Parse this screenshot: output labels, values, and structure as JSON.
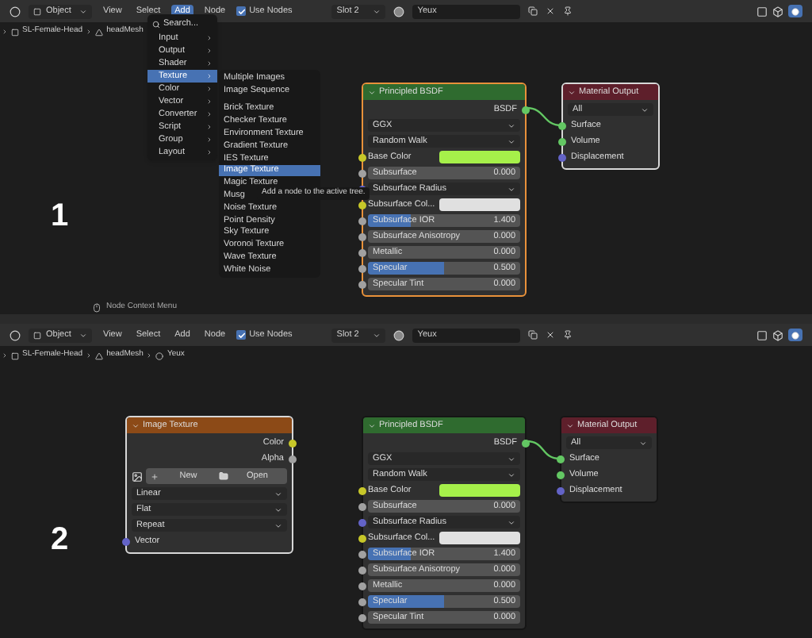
{
  "panels": [
    {
      "number": "1",
      "header": {
        "mode": "Object",
        "menus": [
          {
            "label": "View",
            "selected": false
          },
          {
            "label": "Select",
            "selected": false
          },
          {
            "label": "Add",
            "selected": true
          },
          {
            "label": "Node",
            "selected": false
          }
        ],
        "use_nodes": {
          "label": "Use Nodes",
          "checked": true
        },
        "slot": "Slot 2",
        "material": "Yeux"
      },
      "breadcrumb": [
        {
          "kind": "object",
          "label": "SL-Female-Head"
        },
        {
          "kind": "mesh",
          "label": "headMesh"
        }
      ],
      "nodes": [
        {
          "kind": "shader",
          "title": "Principled BSDF",
          "active": true,
          "selected": true,
          "rows": [
            {
              "kind": "output",
              "label": "BSDF",
              "socket": {
                "color": "#63c763"
              }
            },
            {
              "kind": "dropdown",
              "label": "GGX"
            },
            {
              "kind": "dropdown",
              "label": "Random Walk"
            },
            {
              "kind": "color",
              "label": "Base Color",
              "socket": {
                "color": "#c7c729"
              },
              "color": "#a6f04a"
            },
            {
              "kind": "slider",
              "label": "Subsurface",
              "value": "0.000",
              "socket": {
                "color": "#a1a1a1"
              },
              "level": 0
            },
            {
              "kind": "dropdown",
              "label": "Subsurface Radius",
              "socket": {
                "color": "#6363c7"
              }
            },
            {
              "kind": "color",
              "label": "Subsurface Col...",
              "socket": {
                "color": "#c7c729"
              },
              "color": "#e0e0e0"
            },
            {
              "kind": "slider",
              "label": "Subsurface IOR",
              "value": "1.400",
              "socket": {
                "color": "#a1a1a1"
              },
              "level": 0.28
            },
            {
              "kind": "slider",
              "label": "Subsurface Anisotropy",
              "value": "0.000",
              "socket": {
                "color": "#a1a1a1"
              },
              "level": 0
            },
            {
              "kind": "slider",
              "label": "Metallic",
              "value": "0.000",
              "socket": {
                "color": "#a1a1a1"
              },
              "level": 0
            },
            {
              "kind": "slider",
              "label": "Specular",
              "value": "0.500",
              "socket": {
                "color": "#a1a1a1"
              },
              "level": 0.5
            },
            {
              "kind": "slider",
              "label": "Specular Tint",
              "value": "0.000",
              "socket": {
                "color": "#a1a1a1"
              },
              "level": 0
            }
          ]
        },
        {
          "kind": "output",
          "title": "Material Output",
          "active": false,
          "selected": true,
          "rows": [
            {
              "kind": "dropdown",
              "label": "All"
            },
            {
              "kind": "input",
              "label": "Surface",
              "socket": {
                "color": "#63c763"
              }
            },
            {
              "kind": "input",
              "label": "Volume",
              "socket": {
                "color": "#63c763"
              }
            },
            {
              "kind": "input",
              "label": "Displacement",
              "socket": {
                "color": "#6363c7"
              }
            }
          ]
        }
      ],
      "menu": {
        "items": [
          {
            "label": "Search...",
            "kind": "search",
            "selected": false
          },
          {
            "label": "Input",
            "kind": "submenu",
            "selected": false
          },
          {
            "label": "Output",
            "kind": "submenu",
            "selected": false
          },
          {
            "label": "Shader",
            "kind": "submenu",
            "selected": false
          },
          {
            "label": "Texture",
            "kind": "submenu",
            "selected": true
          },
          {
            "label": "Color",
            "kind": "submenu",
            "selected": false
          },
          {
            "label": "Vector",
            "kind": "submenu",
            "selected": false
          },
          {
            "label": "Converter",
            "kind": "submenu",
            "selected": false
          },
          {
            "label": "Script",
            "kind": "submenu",
            "selected": false
          },
          {
            "label": "Group",
            "kind": "submenu",
            "selected": false
          },
          {
            "label": "Layout",
            "kind": "submenu",
            "selected": false
          }
        ],
        "submenu": [
          {
            "label": "Multiple Images",
            "selected": false
          },
          {
            "label": "Image Sequence",
            "selected": false
          },
          {
            "kind": "separator"
          },
          {
            "label": "Brick Texture",
            "selected": false
          },
          {
            "label": "Checker Texture",
            "selected": false
          },
          {
            "label": "Environment Texture",
            "selected": false
          },
          {
            "label": "Gradient Texture",
            "selected": false
          },
          {
            "label": "IES Texture",
            "selected": false
          },
          {
            "label": "Image Texture",
            "selected": true
          },
          {
            "label": "Magic Texture",
            "selected": false
          },
          {
            "label": "Musg",
            "selected": false
          },
          {
            "label": "Noise Texture",
            "selected": false
          },
          {
            "label": "Point Density",
            "selected": false
          },
          {
            "label": "Sky Texture",
            "selected": false
          },
          {
            "label": "Voronoi Texture",
            "selected": false
          },
          {
            "label": "Wave Texture",
            "selected": false
          },
          {
            "label": "White Noise",
            "selected": false
          }
        ],
        "tooltip": "Add a node to the active tree."
      },
      "status": "Node Context Menu"
    },
    {
      "number": "2",
      "header": {
        "mode": "Object",
        "menus": [
          {
            "label": "View",
            "selected": false
          },
          {
            "label": "Select",
            "selected": false
          },
          {
            "label": "Add",
            "selected": false
          },
          {
            "label": "Node",
            "selected": false
          }
        ],
        "use_nodes": {
          "label": "Use Nodes",
          "checked": true
        },
        "slot": "Slot 2",
        "material": "Yeux"
      },
      "breadcrumb": [
        {
          "kind": "object",
          "label": "SL-Female-Head"
        },
        {
          "kind": "mesh",
          "label": "headMesh"
        },
        {
          "kind": "material",
          "label": "Yeux"
        }
      ],
      "nodes": [
        {
          "kind": "texture",
          "title": "Image Texture",
          "active": false,
          "selected": true,
          "rows": [
            {
              "kind": "output",
              "label": "Color",
              "socket": {
                "color": "#c7c729"
              }
            },
            {
              "kind": "output",
              "label": "Alpha",
              "socket": {
                "color": "#a1a1a1"
              }
            },
            {
              "kind": "image",
              "new": "New",
              "open": "Open"
            },
            {
              "kind": "dropdown",
              "label": "Linear"
            },
            {
              "kind": "dropdown",
              "label": "Flat"
            },
            {
              "kind": "dropdown",
              "label": "Repeat"
            },
            {
              "kind": "input",
              "label": "Vector",
              "socket": {
                "color": "#6363c7"
              }
            }
          ]
        },
        {
          "kind": "shader",
          "title": "Principled BSDF",
          "active": false,
          "selected": false,
          "rows": [
            {
              "kind": "output",
              "label": "BSDF",
              "socket": {
                "color": "#63c763"
              }
            },
            {
              "kind": "dropdown",
              "label": "GGX"
            },
            {
              "kind": "dropdown",
              "label": "Random Walk"
            },
            {
              "kind": "color",
              "label": "Base Color",
              "socket": {
                "color": "#c7c729"
              },
              "color": "#a6f04a"
            },
            {
              "kind": "slider",
              "label": "Subsurface",
              "value": "0.000",
              "socket": {
                "color": "#a1a1a1"
              },
              "level": 0
            },
            {
              "kind": "dropdown",
              "label": "Subsurface Radius",
              "socket": {
                "color": "#6363c7"
              }
            },
            {
              "kind": "color",
              "label": "Subsurface Col...",
              "socket": {
                "color": "#c7c729"
              },
              "color": "#e0e0e0"
            },
            {
              "kind": "slider",
              "label": "Subsurface IOR",
              "value": "1.400",
              "socket": {
                "color": "#a1a1a1"
              },
              "level": 0.28
            },
            {
              "kind": "slider",
              "label": "Subsurface Anisotropy",
              "value": "0.000",
              "socket": {
                "color": "#a1a1a1"
              },
              "level": 0
            },
            {
              "kind": "slider",
              "label": "Metallic",
              "value": "0.000",
              "socket": {
                "color": "#a1a1a1"
              },
              "level": 0
            },
            {
              "kind": "slider",
              "label": "Specular",
              "value": "0.500",
              "socket": {
                "color": "#a1a1a1"
              },
              "level": 0.5
            },
            {
              "kind": "slider",
              "label": "Specular Tint",
              "value": "0.000",
              "socket": {
                "color": "#a1a1a1"
              },
              "level": 0
            }
          ]
        },
        {
          "kind": "output",
          "title": "Material Output",
          "active": false,
          "selected": false,
          "rows": [
            {
              "kind": "dropdown",
              "label": "All"
            },
            {
              "kind": "input",
              "label": "Surface",
              "socket": {
                "color": "#63c763"
              }
            },
            {
              "kind": "input",
              "label": "Volume",
              "socket": {
                "color": "#63c763"
              }
            },
            {
              "kind": "input",
              "label": "Displacement",
              "socket": {
                "color": "#6363c7"
              }
            }
          ]
        }
      ]
    }
  ]
}
